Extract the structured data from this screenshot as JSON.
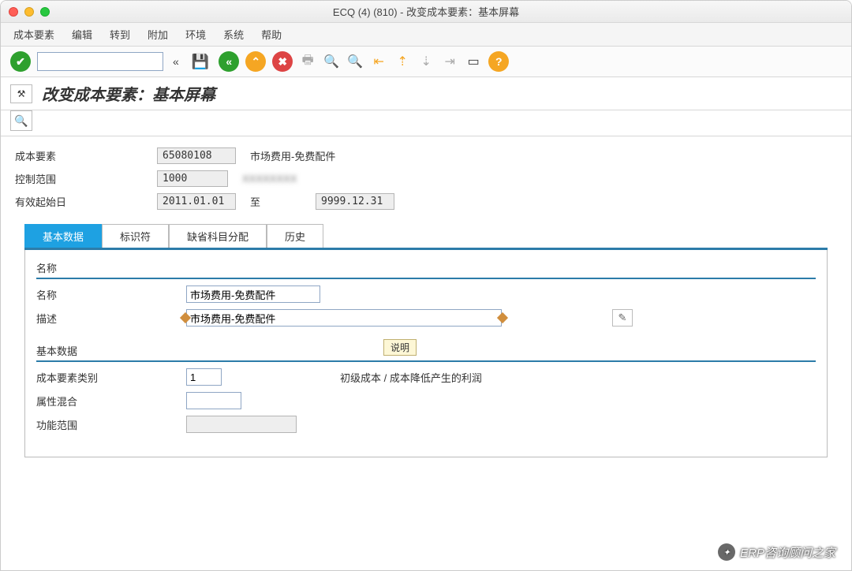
{
  "window": {
    "title": "ECQ (4) (810) - 改变成本要素：基本屏幕"
  },
  "menu": [
    "成本要素",
    "编辑",
    "转到",
    "附加",
    "环境",
    "系统",
    "帮助"
  ],
  "subheader": {
    "title": "改变成本要素：基本屏幕"
  },
  "header_fields": {
    "cost_element_label": "成本要素",
    "cost_element_value": "65080108",
    "cost_element_desc": "市场费用-免费配件",
    "control_area_label": "控制范围",
    "control_area_value": "1000",
    "control_area_desc": "",
    "valid_from_label": "有效起始日",
    "valid_from_value": "2011.01.01",
    "to_label": "至",
    "valid_to_value": "9999.12.31"
  },
  "tabs": [
    {
      "label": "基本数据",
      "active": true
    },
    {
      "label": "标识符",
      "active": false
    },
    {
      "label": "缺省科目分配",
      "active": false
    },
    {
      "label": "历史",
      "active": false
    }
  ],
  "group_name": "名称",
  "name_row": {
    "label": "名称",
    "value": "市场费用-免费配件"
  },
  "desc_row": {
    "label": "描述",
    "value": "市场费用-免费配件"
  },
  "tooltip": "说明",
  "basic_data_group": "基本数据",
  "category_row": {
    "label": "成本要素类别",
    "value": "1",
    "desc": "初级成本 / 成本降低产生的利润"
  },
  "attr_mix_label": "属性混合",
  "func_area_label": "功能范围",
  "watermark": "ERP咨询顾问之家"
}
